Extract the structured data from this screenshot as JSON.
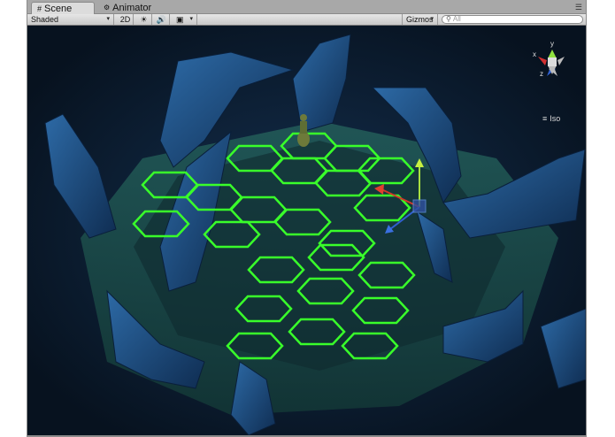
{
  "tabs": [
    {
      "label": "Scene",
      "icon": "scene-grid-icon",
      "active": true
    },
    {
      "label": "Animator",
      "icon": "animator-icon",
      "active": false
    }
  ],
  "toolbar": {
    "draw_mode": "Shaded",
    "mode_2d": "2D",
    "lighting_icon": "sun-icon",
    "audio_icon": "speaker-icon",
    "effects_icon": "image-icon",
    "gizmos_label": "Gizmos",
    "search_placeholder": "All"
  },
  "scene": {
    "projection_label": "Iso",
    "gizmo_axes": [
      "x",
      "y",
      "z"
    ],
    "colors": {
      "background": "#0a1a2c",
      "hex_grid": "#39ff2a",
      "rock": "#1f4a7a",
      "ground": "#1e4f4c"
    }
  }
}
